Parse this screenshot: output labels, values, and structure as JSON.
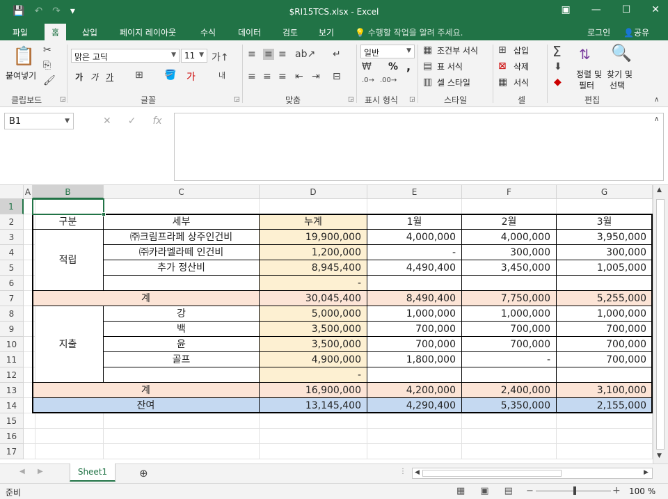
{
  "window": {
    "title": "$RI15TCS.xlsx - Excel",
    "qat": {
      "save_icon": "save-icon",
      "undo_icon": "undo-icon",
      "redo_icon": "redo-icon"
    }
  },
  "ribbon_tabs": [
    "파일",
    "홈",
    "삽입",
    "페이지 레이아웃",
    "수식",
    "데이터",
    "검토",
    "보기"
  ],
  "active_tab": "홈",
  "tell_me": "수행할 작업을 알려 주세요.",
  "login": "로그인",
  "share": "공유",
  "ribbon": {
    "clipboard": {
      "paste": "붙여넣기",
      "label": "클립보드"
    },
    "font": {
      "name": "맑은 고딕",
      "size": "11",
      "bold": "가",
      "italic": "가",
      "underline": "가",
      "label": "글꼴"
    },
    "alignment": {
      "wrap": "내어쓰기",
      "label": "맞춤"
    },
    "number": {
      "format": "일반",
      "percent": "%",
      "comma": ",",
      "label": "표시 형식"
    },
    "styles": {
      "conditional": "조건부 서식",
      "table": "표 서식",
      "cell_styles": "셀 스타일",
      "label": "스타일"
    },
    "cells": {
      "insert": "삽입",
      "delete": "삭제",
      "format": "서식",
      "label": "셀"
    },
    "editing": {
      "sort_filter": "정렬 및",
      "sort_filter2": "필터",
      "find_select": "찾기 및",
      "find_select2": "선택",
      "label": "편집"
    }
  },
  "formula_bar": {
    "name_box": "B1",
    "fx": "fx",
    "formula": ""
  },
  "columns": [
    "A",
    "B",
    "C",
    "D",
    "E",
    "F",
    "G"
  ],
  "rows": [
    "1",
    "2",
    "3",
    "4",
    "5",
    "6",
    "7",
    "8",
    "9",
    "10",
    "11",
    "12",
    "13",
    "14",
    "15",
    "16",
    "17"
  ],
  "table": {
    "header": {
      "category": "구분",
      "detail": "세부",
      "total": "누계",
      "m1": "1월",
      "m2": "2월",
      "m3": "3월"
    },
    "reserve_label": "적립",
    "expense_label": "지출",
    "reserve_rows": [
      {
        "detail": "㈜크림프라페 상주인건비",
        "total": "19,900,000",
        "m1": "4,000,000",
        "m2": "4,000,000",
        "m3": "3,950,000"
      },
      {
        "detail": "㈜카라멜라떼 인건비",
        "total": "1,200,000",
        "m1": "-",
        "m2": "300,000",
        "m3": "300,000"
      },
      {
        "detail": "추가 정산비",
        "total": "8,945,400",
        "m1": "4,490,400",
        "m2": "3,450,000",
        "m3": "1,005,000"
      },
      {
        "detail": "",
        "total": "-",
        "m1": "",
        "m2": "",
        "m3": ""
      }
    ],
    "reserve_sum": {
      "label": "계",
      "total": "30,045,400",
      "m1": "8,490,400",
      "m2": "7,750,000",
      "m3": "5,255,000"
    },
    "expense_rows": [
      {
        "detail": "강",
        "total": "5,000,000",
        "m1": "1,000,000",
        "m2": "1,000,000",
        "m3": "1,000,000"
      },
      {
        "detail": "백",
        "total": "3,500,000",
        "m1": "700,000",
        "m2": "700,000",
        "m3": "700,000"
      },
      {
        "detail": "윤",
        "total": "3,500,000",
        "m1": "700,000",
        "m2": "700,000",
        "m3": "700,000"
      },
      {
        "detail": "골프",
        "total": "4,900,000",
        "m1": "1,800,000",
        "m2": "-",
        "m3": "700,000"
      },
      {
        "detail": "",
        "total": "-",
        "m1": "",
        "m2": "",
        "m3": ""
      }
    ],
    "expense_sum": {
      "label": "계",
      "total": "16,900,000",
      "m1": "4,200,000",
      "m2": "2,400,000",
      "m3": "3,100,000"
    },
    "balance": {
      "label": "잔여",
      "total": "13,145,400",
      "m1": "4,290,400",
      "m2": "5,350,000",
      "m3": "2,155,000"
    }
  },
  "colors": {
    "excel_green": "#217346",
    "total_col": "#fdf0d2",
    "sum_row": "#fce4d6",
    "balance_row": "#c5d9f1"
  },
  "sheet_tab": "Sheet1",
  "status": {
    "ready": "준비",
    "zoom": "100 %"
  }
}
